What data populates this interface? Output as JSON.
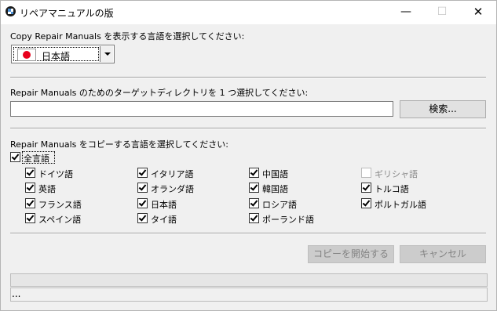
{
  "window": {
    "title": "リペアマニュアルの版",
    "app_icon": "bmw-icon",
    "controls": {
      "minimize": "—",
      "maximize": "☐",
      "close": "✕"
    }
  },
  "display_language": {
    "label": "Copy Repair Manuals を表示する言語を選択してください:",
    "selected": "日本語",
    "flag": "japan-flag-icon"
  },
  "directory": {
    "label": "Repair Manuals のためのターゲットディレクトリを 1 つ選択してください:",
    "value": "",
    "browse_button": "検索..."
  },
  "copy_languages": {
    "label": "Repair Manuals をコピーする言語を選択してください:",
    "all_label": "全言語",
    "all_checked": true,
    "columns": [
      [
        {
          "label": "ドイツ語",
          "checked": true,
          "enabled": true
        },
        {
          "label": "英語",
          "checked": true,
          "enabled": true
        },
        {
          "label": "フランス語",
          "checked": true,
          "enabled": true
        },
        {
          "label": "スペイン語",
          "checked": true,
          "enabled": true
        }
      ],
      [
        {
          "label": "イタリア語",
          "checked": true,
          "enabled": true
        },
        {
          "label": "オランダ語",
          "checked": true,
          "enabled": true
        },
        {
          "label": "日本語",
          "checked": true,
          "enabled": true
        },
        {
          "label": "タイ語",
          "checked": true,
          "enabled": true
        }
      ],
      [
        {
          "label": "中国語",
          "checked": true,
          "enabled": true
        },
        {
          "label": "韓国語",
          "checked": true,
          "enabled": true
        },
        {
          "label": "ロシア語",
          "checked": true,
          "enabled": true
        },
        {
          "label": "ポーランド語",
          "checked": true,
          "enabled": true
        }
      ],
      [
        {
          "label": "ギリシャ語",
          "checked": false,
          "enabled": false
        },
        {
          "label": "トルコ語",
          "checked": true,
          "enabled": true
        },
        {
          "label": "ポルトガル語",
          "checked": true,
          "enabled": true
        }
      ]
    ]
  },
  "actions": {
    "start_copy": "コピーを開始する",
    "cancel": "キャンセル"
  },
  "progress": {
    "value": 0
  },
  "status_text": "..."
}
